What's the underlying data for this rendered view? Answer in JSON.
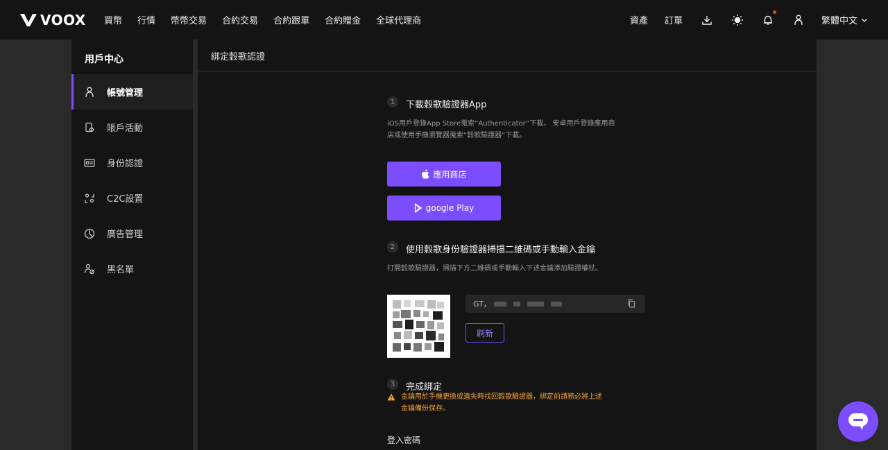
{
  "brand": {
    "name": "VOOX",
    "accent": "#7c4dff"
  },
  "nav": {
    "links": [
      "買幣",
      "行情",
      "幣幣交易",
      "合約交易",
      "合約跟單",
      "合約贈金",
      "全球代理商"
    ],
    "assets": "資產",
    "orders": "訂單",
    "language": "繁體中文",
    "icons": [
      "download-icon",
      "theme-sun-icon",
      "bell-icon",
      "user-icon",
      "chevron-down-icon"
    ]
  },
  "sidebar": {
    "title": "用戶中心",
    "items": [
      {
        "label": "帳號管理",
        "icon": "user-icon",
        "active": true
      },
      {
        "label": "賬戶活動",
        "icon": "activity-icon",
        "active": false
      },
      {
        "label": "身份認證",
        "icon": "id-card-icon",
        "active": false
      },
      {
        "label": "C2C設置",
        "icon": "c2c-icon",
        "active": false
      },
      {
        "label": "廣告管理",
        "icon": "pie-chart-icon",
        "active": false
      },
      {
        "label": "黑名單",
        "icon": "user-block-icon",
        "active": false
      }
    ]
  },
  "main": {
    "header": "綁定穀歌認證",
    "step1": {
      "num": "1",
      "title": "下載穀歌驗證器App",
      "desc_line1": "iOS用戶登錄App Store蒐索“Authenticator”下載。 安卓用戶登錄應用商",
      "desc_line2": "店或使用手機瀏覽器蒐索“穀歌驗證器”下載。",
      "app_store_btn": "應用商店",
      "google_play_btn": "google Play"
    },
    "step2": {
      "num": "2",
      "title": "使用穀歌身份驗證器掃描二維碼或手動輸入金鑰",
      "desc": "打開穀歌驗證器，掃描下方二維碼或手動輸入下述金鑰添加驗證權杖。",
      "key_prefix": "GT，",
      "refresh_btn": "刷新"
    },
    "step3": {
      "num": "3",
      "title": "完成綁定",
      "warn_line1": "金鑰用於手機更換或遺失時找回穀歌驗證器，綁定前請務必將上述",
      "warn_line2": "金鑰備份保存。",
      "warn_color": "#f0a23a"
    },
    "login_password_label": "登入密碼"
  },
  "chat": {
    "icon": "chat-bubble-icon"
  }
}
